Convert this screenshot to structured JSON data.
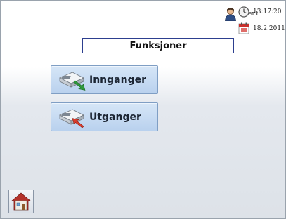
{
  "status": {
    "user": "User1",
    "time": "13:17:20",
    "date": "18.2.2011"
  },
  "title": "Funksjoner",
  "buttons": {
    "inputs_label": "Innganger",
    "outputs_label": "Utganger"
  },
  "icons": {
    "user": "user-icon",
    "clock": "clock-icon",
    "calendar": "calendar-icon",
    "inputs": "device-in-icon",
    "outputs": "device-out-icon",
    "home": "home-icon"
  },
  "colors": {
    "button_bg": "#c6dbf2",
    "title_border": "#2d3f8f",
    "input_arrow": "#2e9a3b",
    "output_arrow": "#d93b2b"
  }
}
